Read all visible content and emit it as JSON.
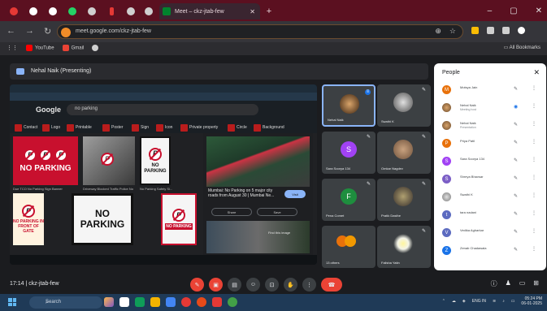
{
  "browser": {
    "active_tab_title": "Meet – ckz-jtab-few",
    "url": "meet.google.com/ckz-jtab-few",
    "bookmarks": [
      "YouTube",
      "Gmail"
    ],
    "all_bookmarks": "All Bookmarks"
  },
  "meet": {
    "presenter_chip": "Nehal Naik (Presenting)",
    "meeting_code_label": "17:14  |  ckz-jtab-few"
  },
  "shared_screen": {
    "google_logo": "Google",
    "query": "no parking",
    "chips": [
      "Contact",
      "Logo",
      "Printable",
      "Poster",
      "Sign",
      "Icon",
      "Private property",
      "Circle",
      "Background"
    ],
    "images": [
      {
        "text": "NO PARKING",
        "caption": "Due TCO No Parking Sign Banner"
      },
      {
        "text": "",
        "caption": "Driveway Blocked Traffic Police No"
      },
      {
        "text": "NO PARKING",
        "caption": "No Parking Safety Si..."
      },
      {
        "text": "",
        "caption": ""
      },
      {
        "text": "NO PARKING IN FRONT OF GATE",
        "caption": ""
      },
      {
        "text": "NO PARKING",
        "caption": ""
      },
      {
        "text": "NO PARKING",
        "caption": ""
      }
    ],
    "panel": {
      "title": "Mumbai: No Parking on 5 major city roads from August 30 | Mumbai Ne...",
      "visit": "Visit",
      "share": "Share",
      "save": "Save",
      "view_more": "Find this image"
    }
  },
  "tiles": [
    {
      "name": "Nehal Naik",
      "type": "photo",
      "color": "#6b4a2b"
    },
    {
      "name": "Swathi K",
      "type": "photo",
      "color": "#7a7a7a"
    },
    {
      "name": "Sara Soorya 134",
      "type": "letter",
      "letter": "S",
      "color": "#a142f4"
    },
    {
      "name": "Omkar Nagdev",
      "type": "photo",
      "color": "#8a6a50"
    },
    {
      "name": "Pena Comet",
      "type": "letter",
      "letter": "F",
      "color": "#1e8e3e"
    },
    {
      "name": "Pratik Dasthe",
      "type": "photo",
      "color": "#5a5040"
    },
    {
      "name": "13 others",
      "type": "group",
      "color": "#e8710a"
    },
    {
      "name": "Falisha Yatin",
      "type": "photo",
      "color": "#f4f4e8"
    }
  ],
  "people": {
    "title": "People",
    "list": [
      {
        "name": "Motsya Jain",
        "sub": "",
        "avatar": "M",
        "color": "#e8710a"
      },
      {
        "name": "Nehal Naik",
        "sub": "Meeting host",
        "avatar": "",
        "color": "#6b4a2b"
      },
      {
        "name": "Nehal Naik",
        "sub": "Presentation",
        "avatar": "",
        "color": "#6b4a2b"
      },
      {
        "name": "Priya Patil",
        "sub": "",
        "avatar": "P",
        "color": "#e8710a"
      },
      {
        "name": "Sara Soorya 134",
        "sub": "",
        "avatar": "S",
        "color": "#a142f4"
      },
      {
        "name": "Shreya Bhavsar",
        "sub": "",
        "avatar": "S",
        "color": "#7b5ec6"
      },
      {
        "name": "Swathi K",
        "sub": "",
        "avatar": "",
        "color": "#7a7a7a"
      },
      {
        "name": "tara nadani",
        "sub": "",
        "avatar": "t",
        "color": "#5c6bc0"
      },
      {
        "name": "Vedika Agharkar",
        "sub": "",
        "avatar": "V",
        "color": "#5c6bc0"
      },
      {
        "name": "Zenab Chadawala",
        "sub": "",
        "avatar": "Z",
        "color": "#1a73e8"
      }
    ]
  },
  "taskbar": {
    "search": "Search",
    "lang": "ENG IN",
    "time": "05:24 PM",
    "date": "06-01-2025"
  }
}
